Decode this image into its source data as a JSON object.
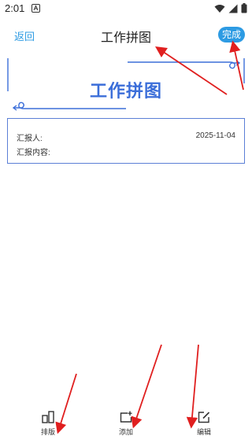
{
  "status_bar": {
    "time": "2:01"
  },
  "header": {
    "back_label": "返回",
    "title": "工作拼图",
    "done_label": "完成"
  },
  "banner": {
    "title": "工作拼图"
  },
  "report": {
    "reporter_label": "汇报人:",
    "date": "2025-11-04",
    "content_label": "汇报内容:"
  },
  "toolbar": {
    "items": [
      {
        "label": "排版",
        "icon": "layout-icon"
      },
      {
        "label": "添加",
        "icon": "add-icon"
      },
      {
        "label": "编辑",
        "icon": "edit-icon"
      }
    ]
  },
  "colors": {
    "accent": "#2d9be3",
    "brand_blue": "#3b6ed9",
    "border_blue": "#5b7fd6",
    "annotation_red": "#e01f1f"
  }
}
